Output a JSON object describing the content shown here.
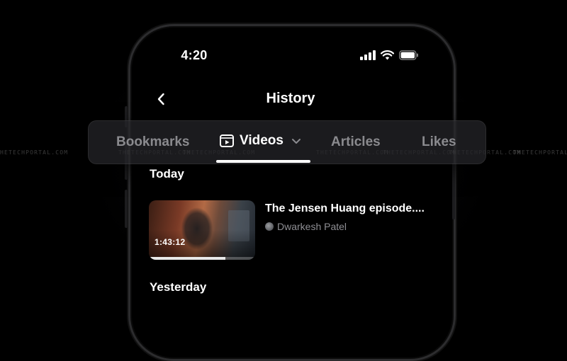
{
  "status_bar": {
    "time": "4:20"
  },
  "header": {
    "title": "History"
  },
  "tabs": [
    {
      "label": "Bookmarks",
      "active": false
    },
    {
      "label": "Videos",
      "active": true
    },
    {
      "label": "Articles",
      "active": false
    },
    {
      "label": "Likes",
      "active": false
    }
  ],
  "watermark_text": "THETECHPORTAL.COM",
  "sections": {
    "today": {
      "label": "Today",
      "items": [
        {
          "title": "The Jensen Huang episode....",
          "channel": "Dwarkesh Patel",
          "duration": "1:43:12",
          "progress": 0.72
        }
      ]
    },
    "yesterday": {
      "label": "Yesterday"
    }
  },
  "colors": {
    "background": "#000000",
    "tab_inactive": "#8a8a8e",
    "tab_active": "#ffffff",
    "secondary_text": "#8e8e93"
  },
  "icons": {
    "back": "chevron-left-icon",
    "videos_tab": "play-square-icon",
    "videos_dropdown": "chevron-down-icon",
    "signal": "cellular-signal-icon",
    "wifi": "wifi-icon",
    "battery": "battery-icon"
  }
}
